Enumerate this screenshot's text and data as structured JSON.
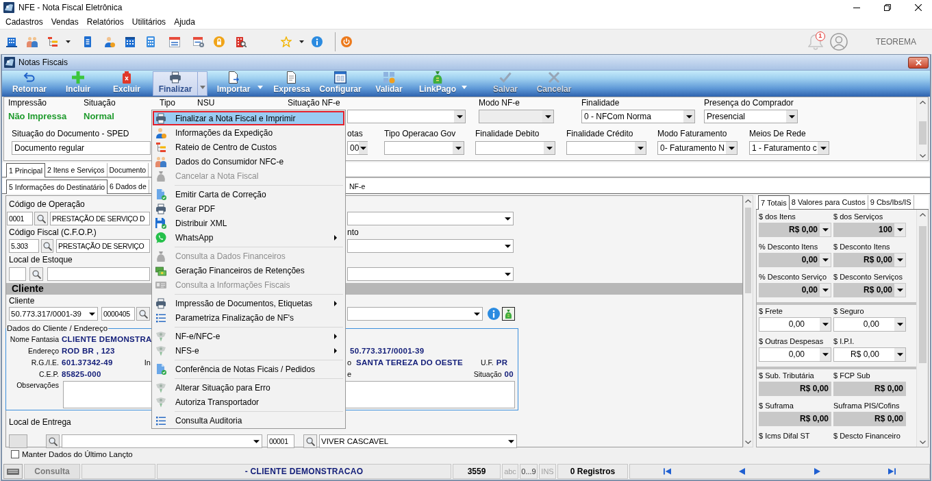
{
  "window": {
    "title": "NFE - Nota Fiscal Eletrônica"
  },
  "menu_bar": [
    {
      "label": "Cadastros"
    },
    {
      "label": "Vendas"
    },
    {
      "label": "Relatórios"
    },
    {
      "label": "Utilitários"
    },
    {
      "label": "Ajuda"
    }
  ],
  "user_area": {
    "notification_count": "1",
    "user_name": "TEOREMA"
  },
  "child_window": {
    "title": "Notas Fiscais",
    "actions": [
      {
        "label": "Retornar",
        "selected": false,
        "disabled": false,
        "dropdown": false
      },
      {
        "label": "Incluir",
        "selected": false,
        "disabled": false,
        "dropdown": false
      },
      {
        "label": "Excluir",
        "selected": false,
        "disabled": false,
        "dropdown": false
      },
      {
        "label": "Finalizar",
        "selected": true,
        "disabled": false,
        "dropdown": true
      },
      {
        "label": "Importar",
        "selected": false,
        "disabled": false,
        "dropdown": true
      },
      {
        "label": "Expressa",
        "selected": false,
        "disabled": false,
        "dropdown": false
      },
      {
        "label": "Configurar",
        "selected": false,
        "disabled": false,
        "dropdown": false
      },
      {
        "label": "Validar",
        "selected": false,
        "disabled": false,
        "dropdown": false
      },
      {
        "label": "LinkPago",
        "selected": false,
        "disabled": false,
        "dropdown": true
      },
      {
        "label": "Salvar",
        "selected": false,
        "disabled": true,
        "dropdown": false
      },
      {
        "label": "Cancelar",
        "selected": false,
        "disabled": true,
        "dropdown": false
      }
    ],
    "header_form": {
      "row_1": [
        {
          "label": "Impressão",
          "kind": "status",
          "value": "Não Impressa",
          "disabled": false
        },
        {
          "label": "Situação",
          "kind": "status",
          "value": "Normal",
          "disabled": false
        },
        {
          "label": "Tipo",
          "kind": "label",
          "disabled": false
        },
        {
          "label": "NSU",
          "kind": "label",
          "disabled": false
        },
        {
          "label": "Situação NF-e",
          "kind": "select",
          "disabled": false
        },
        {
          "label": "Modo NF-e",
          "kind": "select",
          "disabled": true
        },
        {
          "label": "Finalidade",
          "kind": "select",
          "value": "0 - NFCom Norma",
          "disabled": false
        },
        {
          "label": "Presença do Comprador",
          "kind": "select",
          "value": "Presencial",
          "disabled": false
        }
      ],
      "row_2": [
        {
          "label": "Situação do Documento - SPED",
          "kind": "text",
          "value": "Documento regular",
          "disabled": false
        },
        {
          "label": "otas",
          "kind": "select",
          "value": "00",
          "disabled": false
        },
        {
          "label": "Tipo Operacao Gov",
          "kind": "select",
          "disabled": false
        },
        {
          "label": "Finalidade Debito",
          "kind": "select",
          "disabled": false
        },
        {
          "label": "Finalidade Crédito",
          "kind": "select",
          "disabled": false
        },
        {
          "label": "Modo Faturamento",
          "kind": "select",
          "value": "0- Faturamento N",
          "disabled": false
        },
        {
          "label": "Meios De Rede",
          "kind": "select",
          "value": "1 - Faturamento c",
          "disabled": false
        }
      ]
    },
    "tabs_row_1": [
      {
        "label": "1 Principal",
        "selected": true
      },
      {
        "label": "2 Itens e Serviços",
        "selected": false
      },
      {
        "label": "Documento",
        "selected": false
      }
    ],
    "tabs_row_2": [
      {
        "label": "5 Informações do Destinatário",
        "selected": true
      },
      {
        "label": "6 Dados de",
        "selected": false
      },
      {
        "label": "NF-e",
        "selected": false
      }
    ],
    "main_form": {
      "operation": {
        "label": "Código de Operação",
        "code": "0001",
        "description": "PRESTAÇÃO DE SERVIÇO D"
      },
      "cfop": {
        "label": "Código Fiscal (C.F.O.P.)",
        "side_label": "nto",
        "code": "5.303",
        "description": "PRESTAÇÃO DE SERVIÇO"
      },
      "stock_location": {
        "label": "Local de Estoque"
      },
      "client": {
        "section_title": "Cliente",
        "label": "Cliente",
        "document": "50.773.317/0001-39",
        "code": "0000405"
      },
      "client_address": {
        "legend": "Dados do Cliente / Endereço",
        "trade_name": {
          "label": "Nome Fantasia",
          "value": "CLIENTE DEMONSTRA"
        },
        "address": {
          "label": "Endereço",
          "value": "ROD BR , 123",
          "side_value": "50.773.317/0001-39"
        },
        "registration": {
          "label": "R.G./I.E.",
          "value": "601.37342-49",
          "side_label": "In",
          "right_label": "o",
          "right_value": "SANTA TEREZA DO OESTE",
          "state_label": "U.F.",
          "state_value": "PR"
        },
        "zip": {
          "label": "C.E.P.",
          "value": "85825-000",
          "right_label": "e",
          "status_label": "Situação",
          "status_value": "00"
        },
        "notes": {
          "label": "Observações"
        }
      },
      "delivery_location": {
        "label": "Local de Entrega",
        "disabled": true,
        "code": "00001",
        "description": "VIVER CASCAVEL"
      }
    },
    "totals_panel": {
      "tabs": [
        {
          "label": "7 Totais",
          "selected": true
        },
        {
          "label": "8 Valores para Custos",
          "selected": false
        },
        {
          "label": "9 Cbs/Ibs/IS",
          "selected": false
        }
      ],
      "groups": [
        {
          "fields": [
            {
              "label": "$ dos Itens",
              "value": "R$ 0,00",
              "readonly": true,
              "dropdown": true
            },
            {
              "label": "$ dos Serviços",
              "value": "100",
              "readonly": true,
              "dropdown": true
            },
            {
              "label": "% Desconto Itens",
              "value": "0,00",
              "readonly": true,
              "dropdown": true
            },
            {
              "label": "$ Desconto Itens",
              "value": "R$ 0,00",
              "readonly": true,
              "dropdown": true
            },
            {
              "label": "% Desconto Serviço",
              "value": "0,00",
              "readonly": true,
              "dropdown": true
            },
            {
              "label": "$ Desconto Serviços",
              "value": "R$ 0,00",
              "readonly": true,
              "dropdown": true
            }
          ]
        },
        {
          "fields": [
            {
              "label": "$ Frete",
              "value": "0,00",
              "readonly": false,
              "dropdown": true
            },
            {
              "label": "$ Seguro",
              "value": "0,00",
              "readonly": false,
              "dropdown": true
            },
            {
              "label": "$ Outras Despesas",
              "value": "0,00",
              "readonly": false,
              "dropdown": true
            },
            {
              "label": "$ I.P.I.",
              "value": "R$ 0,00",
              "readonly": false,
              "dropdown": true
            }
          ]
        },
        {
          "fields": [
            {
              "label": "$ Sub. Tributária",
              "value": "R$ 0,00",
              "readonly": true,
              "dropdown": false
            },
            {
              "label": "$ FCP Sub",
              "value": "R$ 0,00",
              "readonly": true,
              "dropdown": false
            },
            {
              "label": "$ Suframa",
              "value": "R$ 0,00",
              "readonly": true,
              "dropdown": false
            },
            {
              "label": "Suframa PIS/Cofins",
              "value": "R$ 0,00",
              "readonly": true,
              "dropdown": false
            }
          ]
        }
      ],
      "last_row_labels": [
        {
          "label": "$ Icms Difal ST"
        },
        {
          "label": "$ Descto Financeiro"
        }
      ]
    },
    "keep_last_data": {
      "label": "Manter Dados do Último Lançto",
      "checked": false
    },
    "status_bar": {
      "mode": "Consulta",
      "client": "- CLIENTE DEMONSTRACAO",
      "number": "3559",
      "indicators": [
        {
          "label": "abc",
          "on": false
        },
        {
          "label": "0...9",
          "on": true
        },
        {
          "label": "INS",
          "on": false
        }
      ],
      "records": "0 Registros"
    }
  },
  "finalize_menu": {
    "groups": [
      {
        "items": [
          {
            "label": "Finalizar a Nota Fiscal e Imprimir",
            "selected": true,
            "disabled": false,
            "submenu": false
          },
          {
            "label": "Informações da Expedição",
            "selected": false,
            "disabled": false,
            "submenu": false
          },
          {
            "label": "Rateio de Centro de Custos",
            "selected": false,
            "disabled": false,
            "submenu": false
          },
          {
            "label": "Dados do Consumidor NFC-e",
            "selected": false,
            "disabled": false,
            "submenu": false
          },
          {
            "label": "Cancelar a Nota Fiscal",
            "selected": false,
            "disabled": true,
            "submenu": false
          }
        ]
      },
      {
        "items": [
          {
            "label": "Emitir Carta de Correção",
            "selected": false,
            "disabled": false,
            "submenu": false
          },
          {
            "label": "Gerar PDF",
            "selected": false,
            "disabled": false,
            "submenu": false
          },
          {
            "label": "Distribuir XML",
            "selected": false,
            "disabled": false,
            "submenu": false
          },
          {
            "label": "WhatsApp",
            "selected": false,
            "disabled": false,
            "submenu": true
          }
        ]
      },
      {
        "items": [
          {
            "label": "Consulta a Dados Financeiros",
            "selected": false,
            "disabled": true,
            "submenu": false
          },
          {
            "label": "Geração Financeiros de Retenções",
            "selected": false,
            "disabled": false,
            "submenu": false
          },
          {
            "label": "Consulta a Informações Fiscais",
            "selected": false,
            "disabled": true,
            "submenu": false
          }
        ]
      },
      {
        "items": [
          {
            "label": "Impressão de Documentos, Etiquetas",
            "selected": false,
            "disabled": false,
            "submenu": true
          },
          {
            "label": "Parametriza Finalização de NF's",
            "selected": false,
            "disabled": false,
            "submenu": false
          }
        ]
      },
      {
        "items": [
          {
            "label": "NF-e/NFC-e",
            "selected": false,
            "disabled": false,
            "submenu": true
          },
          {
            "label": "NFS-e",
            "selected": false,
            "disabled": false,
            "submenu": true
          }
        ]
      },
      {
        "items": [
          {
            "label": "Conferência de Notas Ficais / Pedidos",
            "selected": false,
            "disabled": false,
            "submenu": false
          }
        ]
      },
      {
        "items": [
          {
            "label": "Alterar Situação para Erro",
            "selected": false,
            "disabled": false,
            "submenu": false
          },
          {
            "label": "Autoriza Transportador",
            "selected": false,
            "disabled": false,
            "submenu": false
          }
        ]
      },
      {
        "items": [
          {
            "label": "Consulta Auditoria",
            "selected": false,
            "disabled": false,
            "submenu": false
          }
        ]
      }
    ]
  }
}
